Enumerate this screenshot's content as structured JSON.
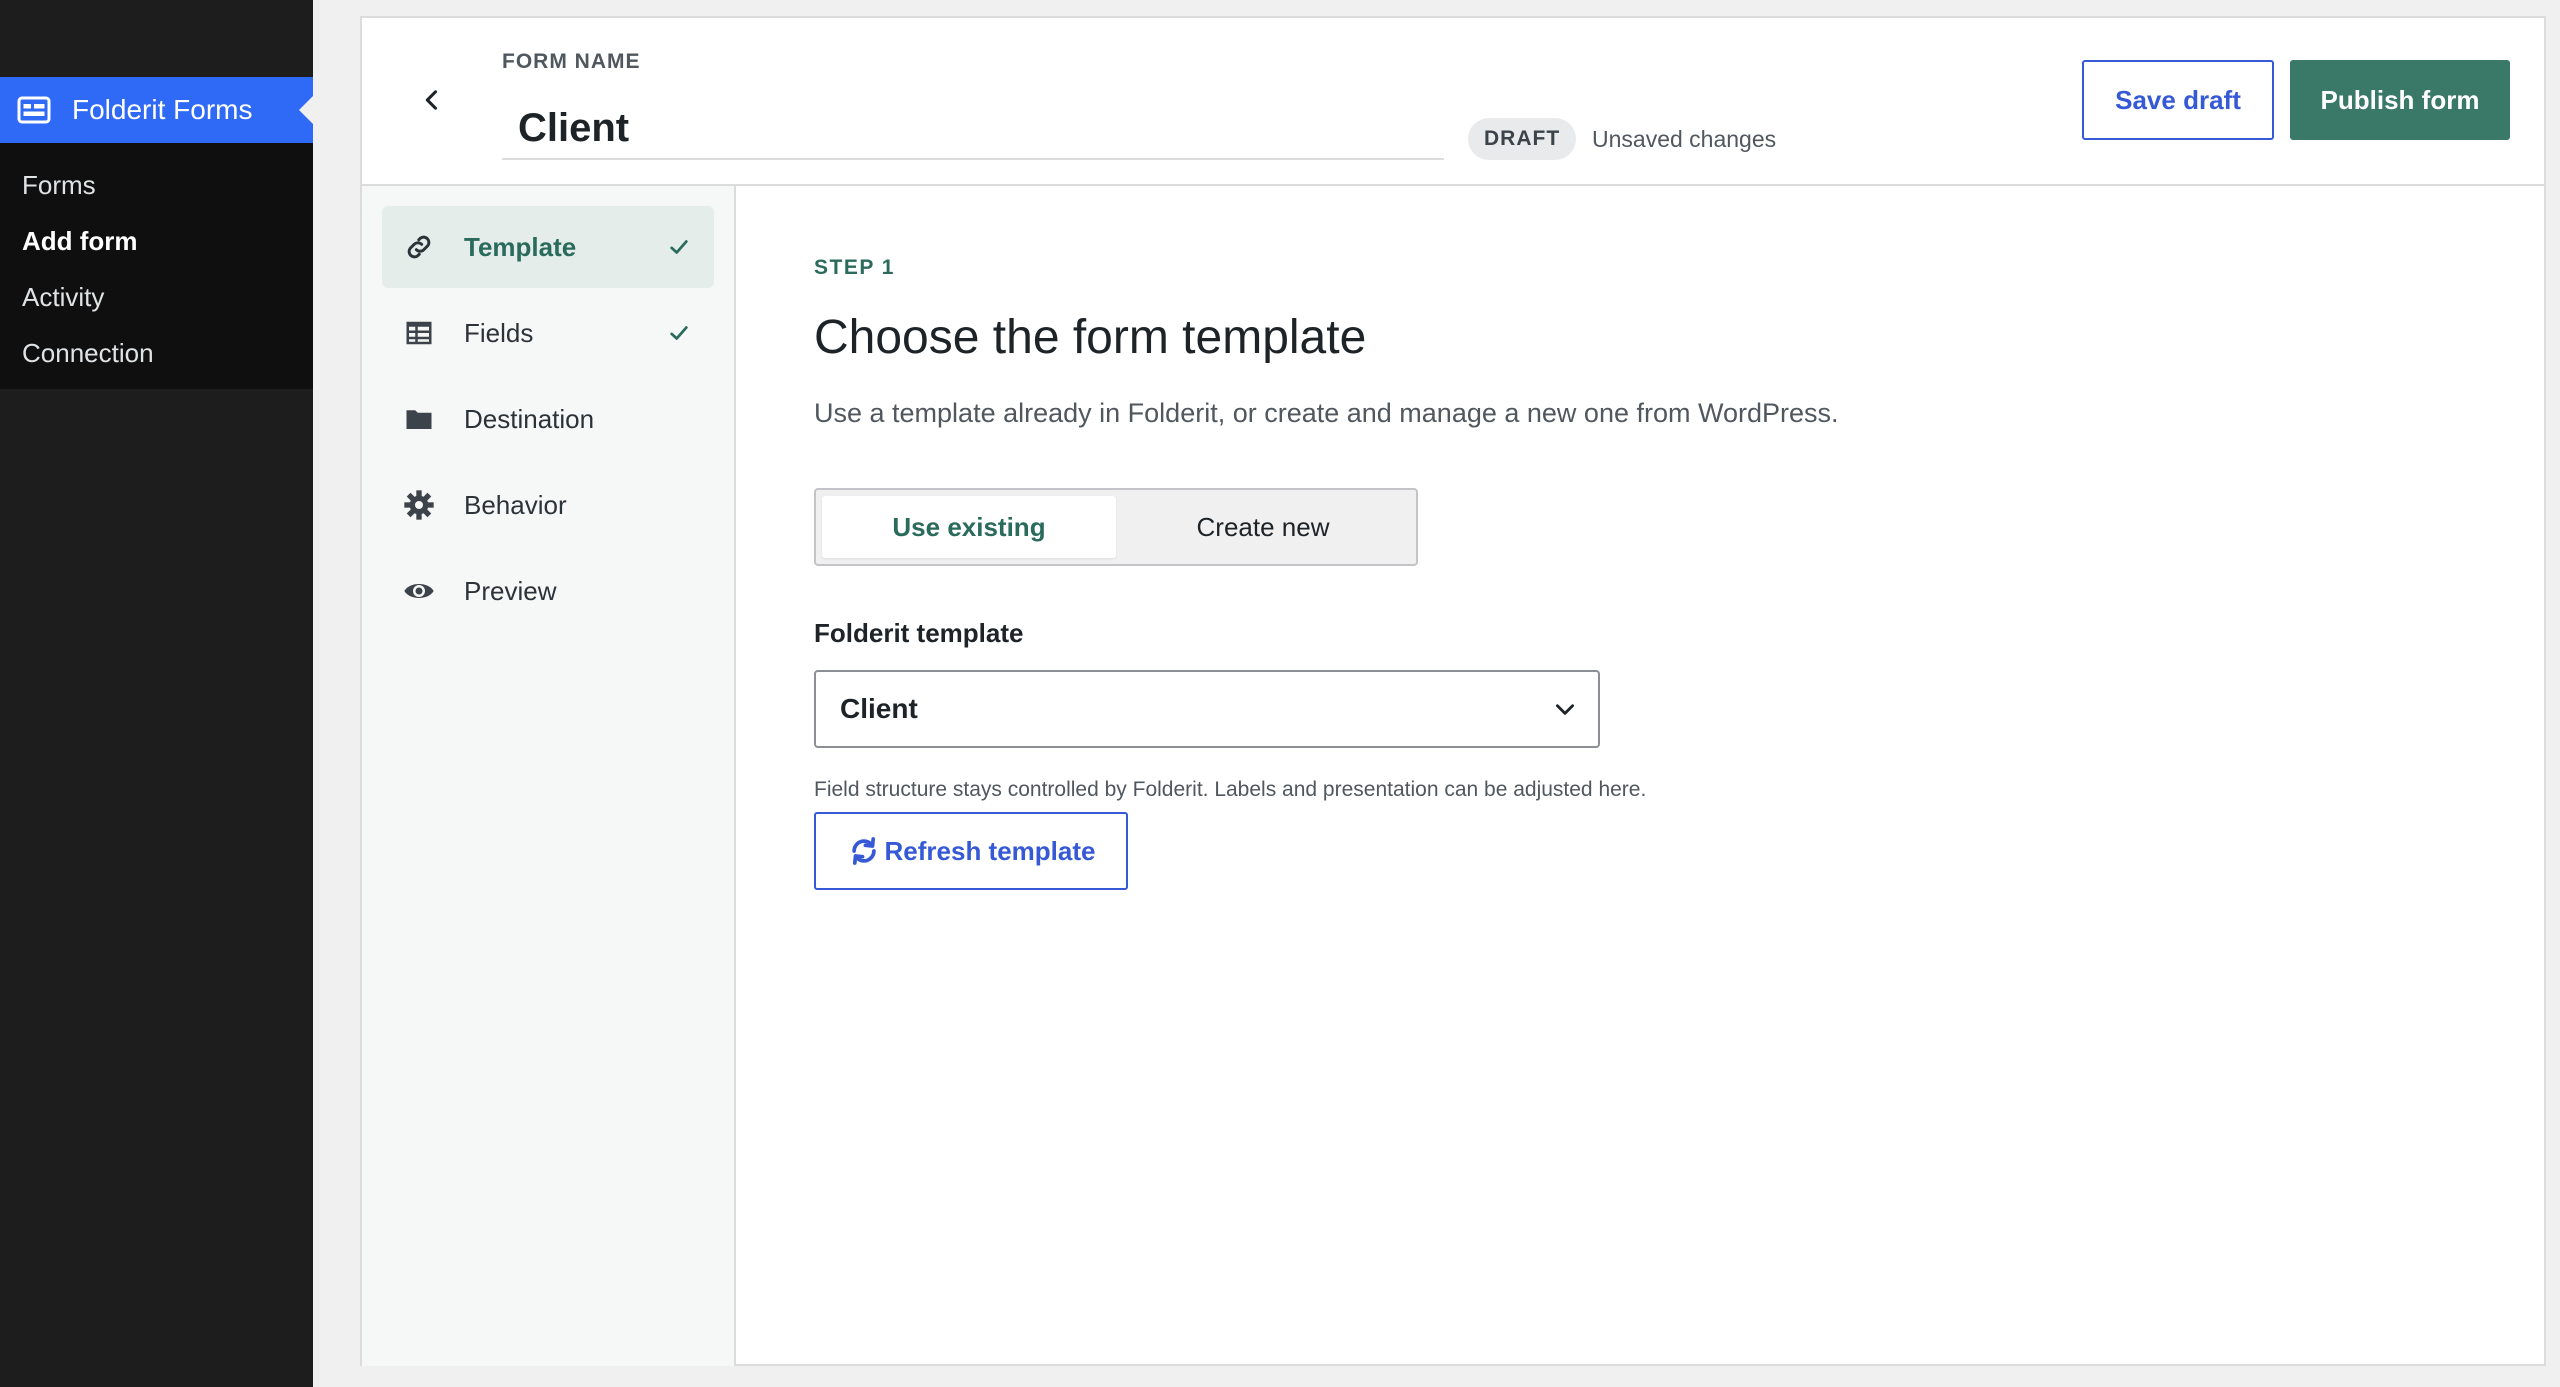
{
  "wp_menu": {
    "title": "Folderit Forms",
    "icon": "forms-icon",
    "items": [
      {
        "label": "Forms",
        "active": false
      },
      {
        "label": "Add form",
        "active": true
      },
      {
        "label": "Activity",
        "active": false
      },
      {
        "label": "Connection",
        "active": false
      }
    ]
  },
  "header": {
    "form_name_label": "FORM NAME",
    "form_name_value": "Client",
    "status_badge": "DRAFT",
    "status_text": "Unsaved changes",
    "save_draft_label": "Save draft",
    "publish_label": "Publish form"
  },
  "steps": [
    {
      "label": "Template",
      "icon": "link-icon",
      "done": true,
      "active": true
    },
    {
      "label": "Fields",
      "icon": "table-icon",
      "done": true,
      "active": false
    },
    {
      "label": "Destination",
      "icon": "folder-icon",
      "done": false,
      "active": false
    },
    {
      "label": "Behavior",
      "icon": "gear-icon",
      "done": false,
      "active": false
    },
    {
      "label": "Preview",
      "icon": "eye-icon",
      "done": false,
      "active": false
    }
  ],
  "main": {
    "kicker": "STEP 1",
    "title": "Choose the form template",
    "description": "Use a template already in Folderit, or create and manage a new one from WordPress.",
    "segmented": {
      "use_existing": "Use existing",
      "create_new": "Create new",
      "selected": "Use existing"
    },
    "template_field_label": "Folderit template",
    "template_selected": "Client",
    "help_text": "Field structure stays controlled by Folderit. Labels and presentation can be adjusted here.",
    "refresh_label": "Refresh template"
  },
  "colors": {
    "accent_blue": "#3659d6",
    "accent_green": "#3a7868",
    "wp_menu_highlight": "#2e6af5"
  }
}
